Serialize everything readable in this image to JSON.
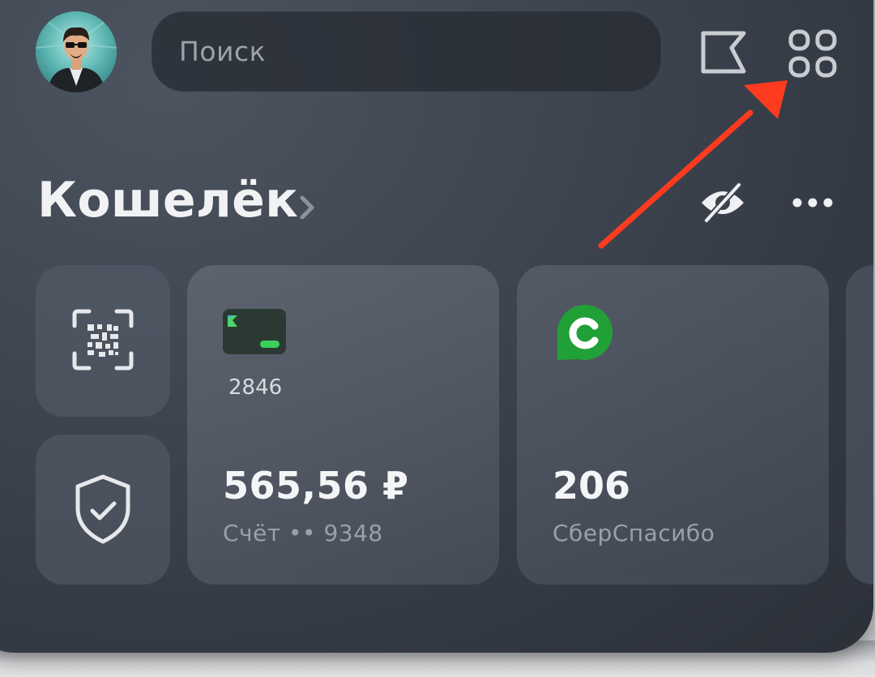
{
  "header": {
    "avatar_icon": "user-avatar",
    "search_placeholder": "Поиск",
    "flag_icon": "flag-icon",
    "apps_icon": "apps-grid-icon"
  },
  "wallet": {
    "title": "Кошелёк",
    "chevron_icon": "chevron-right-icon",
    "hide_balance_icon": "eye-off-icon",
    "more_icon": "more-horizontal-icon"
  },
  "tiles": {
    "qr_icon": "qr-scan-icon",
    "security_icon": "shield-check-icon",
    "card": {
      "last4": "2846",
      "balance": "565,56 ₽",
      "account": "Счёт •• 9348"
    },
    "bonus": {
      "value": "206",
      "label": "СберСпасибо"
    }
  },
  "annotation": {
    "arrow_color": "#ff3b1f"
  },
  "colors": {
    "brand_green": "#21a038",
    "background": "#3f4651"
  }
}
